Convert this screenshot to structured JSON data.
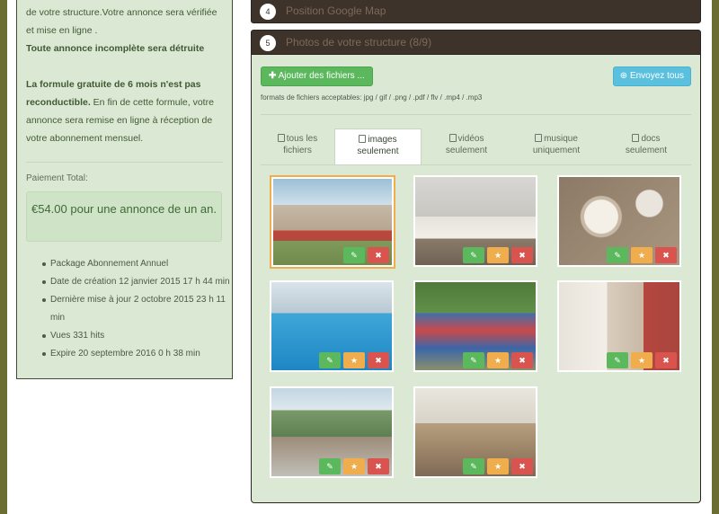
{
  "sidebar": {
    "line1": "de votre structure.Votre annonce sera vérifiée",
    "line2": "et mise en ligne .",
    "warning": "Toute annonce incomplète sera détruite",
    "formula_bold": "La formule gratuite de 6 mois n'est pas reconductible.",
    "formula_rest": " En fin de cette formule, votre annonce sera remise en ligne à réception de votre abonnement mensuel.",
    "payment_label": "Paiement Total:",
    "price": "€54.00 pour une annonce de un an.",
    "details": [
      "Package Abonnement Annuel",
      "Date de création 12 janvier 2015 17 h 44 min",
      "Dernière mise à jour 2 octobre 2015 23 h 11 min",
      "Vues 331 hits",
      "Expire 20 septembre 2016 0 h 38 min"
    ]
  },
  "panel4": {
    "num": "4",
    "title": "Position Google Map"
  },
  "panel5": {
    "num": "5",
    "title": "Photos de votre structure (8/9)"
  },
  "upload": {
    "add_label": "Ajouter des fichiers ...",
    "send_label": "Envoyez tous",
    "formats": "formats de fichiers acceptables: jpg / gif / .png / .pdf / flv / .mp4 / .mp3"
  },
  "tabs": [
    {
      "l1": "tous les",
      "l2": "fichiers",
      "icon": "files-icon"
    },
    {
      "l1": "images",
      "l2": "seulement",
      "icon": "image-icon"
    },
    {
      "l1": "vidéos",
      "l2": "seulement",
      "icon": "video-icon"
    },
    {
      "l1": "musique",
      "l2": "uniquement",
      "icon": "music-icon"
    },
    {
      "l1": "docs",
      "l2": "seulement",
      "icon": "doc-icon"
    }
  ],
  "active_tab": 1,
  "actions": {
    "edit": "✎",
    "star": "★",
    "delete": "✖"
  },
  "colors": {
    "edit": "#5cb85c",
    "star": "#f0ad4e",
    "delete": "#d9534f",
    "header": "#3e332a",
    "panel_bg": "#dbe8d4"
  }
}
